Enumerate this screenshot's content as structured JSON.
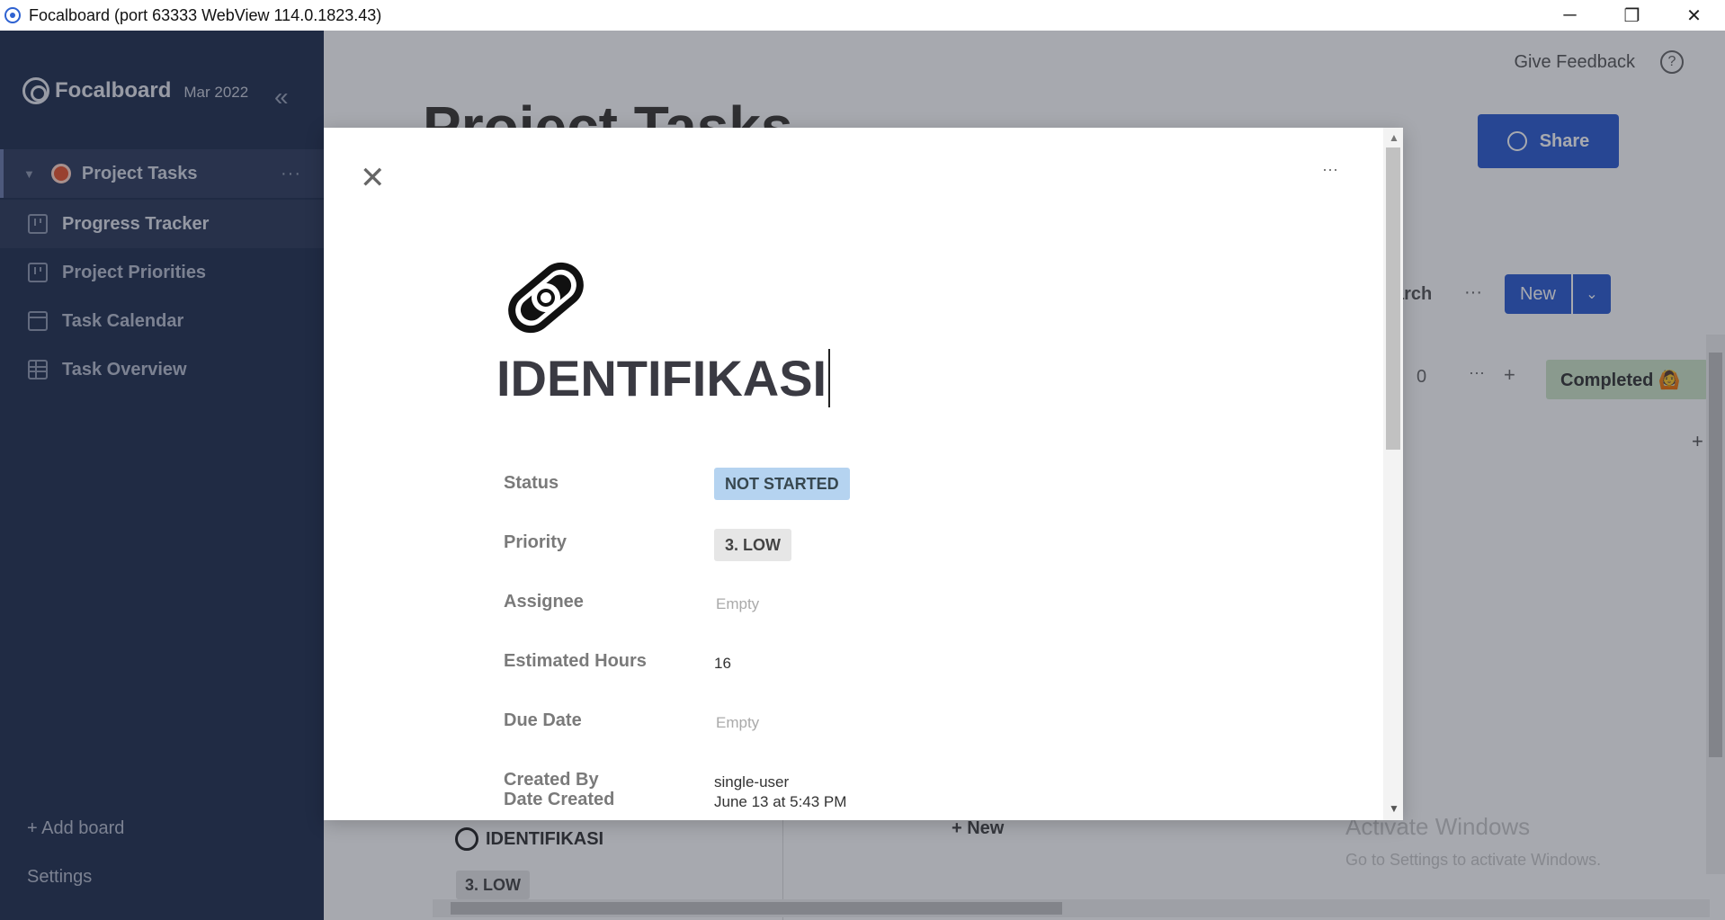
{
  "window": {
    "title": "Focalboard (port 63333 WebView 114.0.1823.43)",
    "minimize": "─",
    "restore": "❐",
    "close": "✕"
  },
  "sidebar": {
    "logo": "Focalboard",
    "version": "Mar 2022",
    "collapse": "«",
    "board": {
      "caret": "▼",
      "label": "Project Tasks",
      "more": "···"
    },
    "views": [
      {
        "label": "Progress Tracker",
        "icon": "board-view-icon"
      },
      {
        "label": "Project Priorities",
        "icon": "board-view-icon"
      },
      {
        "label": "Task Calendar",
        "icon": "calendar-view-icon"
      },
      {
        "label": "Task Overview",
        "icon": "table-view-icon"
      }
    ],
    "add_board": "+ Add board",
    "settings": "Settings"
  },
  "main": {
    "feedback": "Give Feedback",
    "help": "?",
    "share": "Share",
    "title": "Project Tasks",
    "search": "arch",
    "more": "···",
    "new": "New",
    "new_caret": "⌄",
    "column_count": "0",
    "column_more": "···",
    "column_plus": "+",
    "completed": "Completed 🙆",
    "plus_right": "+",
    "card_title": "IDENTIFIKASI",
    "card_badge": "3. LOW",
    "add_new": "+ New",
    "watermark_title": "Activate Windows",
    "watermark_sub": "Go to Settings to activate Windows."
  },
  "dialog": {
    "close": "✕",
    "more": "···",
    "card_name": "IDENTIFIKASI",
    "properties": [
      {
        "name": "Status",
        "value": "NOT STARTED",
        "type": "tag"
      },
      {
        "name": "Priority",
        "value": "3. LOW",
        "type": "tag"
      },
      {
        "name": "Assignee",
        "value": "Empty",
        "type": "empty"
      },
      {
        "name": "Estimated Hours",
        "value": "16",
        "type": "text"
      },
      {
        "name": "Due Date",
        "value": "Empty",
        "type": "empty"
      },
      {
        "name": "Created By",
        "value": "single-user",
        "type": "text"
      },
      {
        "name": "Date Created",
        "value": "June 13 at 5:43 PM",
        "type": "text"
      }
    ],
    "scroll_up": "▲",
    "scroll_down": "▼"
  },
  "colors": {
    "sidebar_bg": "#1f2d4d",
    "accent": "#2b5bd1",
    "status_tag": "#b5d3f0",
    "priority_tag": "#e6e6e6",
    "completed_tag": "#cfe7c9"
  }
}
